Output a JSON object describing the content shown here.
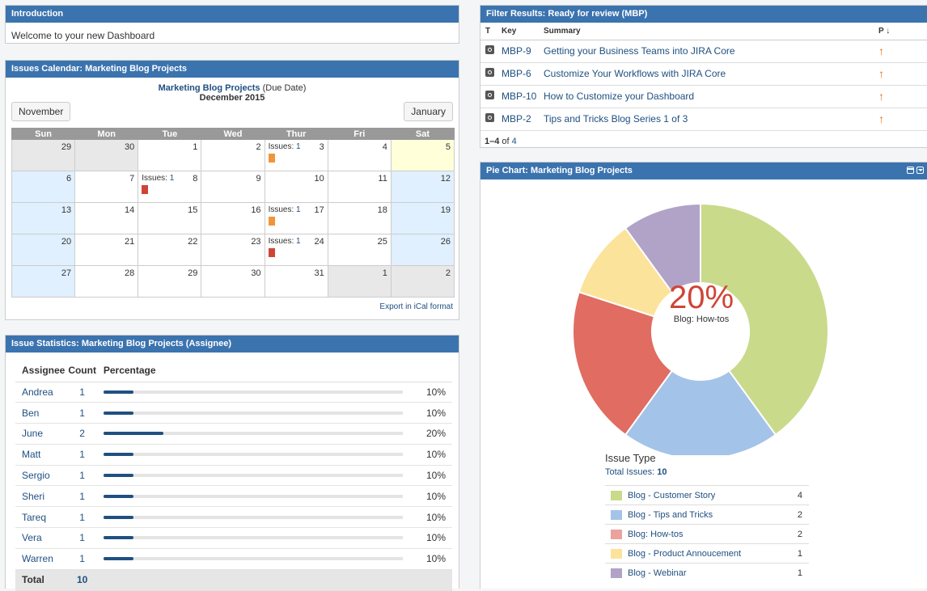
{
  "intro": {
    "title": "Introduction",
    "text": "Welcome to your new Dashboard"
  },
  "calendar": {
    "title": "Issues Calendar: Marketing Blog Projects",
    "project_link": "Marketing Blog Projects",
    "project_suffix": " (Due Date)",
    "month": "December 2015",
    "prev_label": "November",
    "next_label": "January",
    "weekdays": [
      "Sun",
      "Mon",
      "Tue",
      "Wed",
      "Thur",
      "Fri",
      "Sat"
    ],
    "weeks": [
      [
        {
          "d": "29",
          "t": "other"
        },
        {
          "d": "30",
          "t": "other"
        },
        {
          "d": "1"
        },
        {
          "d": "2"
        },
        {
          "d": "3",
          "issues": "1",
          "color": "#f0953a"
        },
        {
          "d": "4"
        },
        {
          "d": "5",
          "t": "today"
        }
      ],
      [
        {
          "d": "6",
          "t": "weekend"
        },
        {
          "d": "7"
        },
        {
          "d": "8",
          "issues": "1",
          "color": "#d04437"
        },
        {
          "d": "9"
        },
        {
          "d": "10"
        },
        {
          "d": "11"
        },
        {
          "d": "12",
          "t": "weekend"
        }
      ],
      [
        {
          "d": "13",
          "t": "weekend"
        },
        {
          "d": "14"
        },
        {
          "d": "15"
        },
        {
          "d": "16"
        },
        {
          "d": "17",
          "issues": "1",
          "color": "#f0953a"
        },
        {
          "d": "18"
        },
        {
          "d": "19",
          "t": "weekend"
        }
      ],
      [
        {
          "d": "20",
          "t": "weekend"
        },
        {
          "d": "21"
        },
        {
          "d": "22"
        },
        {
          "d": "23"
        },
        {
          "d": "24",
          "issues": "1",
          "color": "#d04437"
        },
        {
          "d": "25"
        },
        {
          "d": "26",
          "t": "weekend"
        }
      ],
      [
        {
          "d": "27",
          "t": "weekend"
        },
        {
          "d": "28"
        },
        {
          "d": "29"
        },
        {
          "d": "30"
        },
        {
          "d": "31"
        },
        {
          "d": "1",
          "t": "other"
        },
        {
          "d": "2",
          "t": "other"
        }
      ]
    ],
    "issues_label": "Issues: ",
    "export_label": "Export in iCal format"
  },
  "stats": {
    "title": "Issue Statistics: Marketing Blog Projects (Assignee)",
    "headers": [
      "Assignee",
      "Count",
      "Percentage"
    ],
    "rows": [
      {
        "name": "Andrea",
        "count": "1",
        "pct": "10%",
        "frac": 0.1
      },
      {
        "name": "Ben",
        "count": "1",
        "pct": "10%",
        "frac": 0.1
      },
      {
        "name": "June",
        "count": "2",
        "pct": "20%",
        "frac": 0.2
      },
      {
        "name": "Matt",
        "count": "1",
        "pct": "10%",
        "frac": 0.1
      },
      {
        "name": "Sergio",
        "count": "1",
        "pct": "10%",
        "frac": 0.1
      },
      {
        "name": "Sheri",
        "count": "1",
        "pct": "10%",
        "frac": 0.1
      },
      {
        "name": "Tareq",
        "count": "1",
        "pct": "10%",
        "frac": 0.1
      },
      {
        "name": "Vera",
        "count": "1",
        "pct": "10%",
        "frac": 0.1
      },
      {
        "name": "Warren",
        "count": "1",
        "pct": "10%",
        "frac": 0.1
      }
    ],
    "total_label": "Total",
    "total_count": "10"
  },
  "filter": {
    "title": "Filter Results: Ready for review (MBP)",
    "headers": {
      "t": "T",
      "key": "Key",
      "summary": "Summary",
      "p": "P ↓"
    },
    "rows": [
      {
        "key": "MBP-9",
        "summary": "Getting your Business Teams into JIRA Core",
        "prio": "↑"
      },
      {
        "key": "MBP-6",
        "summary": "Customize Your Workflows with JIRA Core",
        "prio": "↑"
      },
      {
        "key": "MBP-10",
        "summary": "How to Customize your Dashboard",
        "prio": "↑"
      },
      {
        "key": "MBP-2",
        "summary": "Tips and Tricks Blog Series 1 of 3",
        "prio": "↑"
      }
    ],
    "count_range": "1–4",
    "count_of": " of ",
    "count_total": "4"
  },
  "pie": {
    "title": "Pie Chart: Marketing Blog Projects",
    "center_value": "20%",
    "center_label": "Blog: How-tos",
    "legend_title": "Issue Type",
    "total_label": "Total Issues: ",
    "total_value": "10",
    "controls": [
      "maximize-icon",
      "dropdown-icon"
    ]
  },
  "chart_data": {
    "type": "pie",
    "title": "Issue Type",
    "categories": [
      "Blog - Customer Story",
      "Blog - Tips and Tricks",
      "Blog: How-tos",
      "Blog - Product Annoucement",
      "Blog - Webinar"
    ],
    "values": [
      4,
      2,
      2,
      1,
      1
    ],
    "colors": [
      "#c9da8a",
      "#a4c3e8",
      "#e06c62",
      "#fbe39b",
      "#b1a3c7"
    ],
    "legend_colors": [
      "#c9da8a",
      "#a4c3e8",
      "#e9a39c",
      "#fbe39b",
      "#b1a3c7"
    ],
    "highlighted": "Blog: How-tos"
  }
}
